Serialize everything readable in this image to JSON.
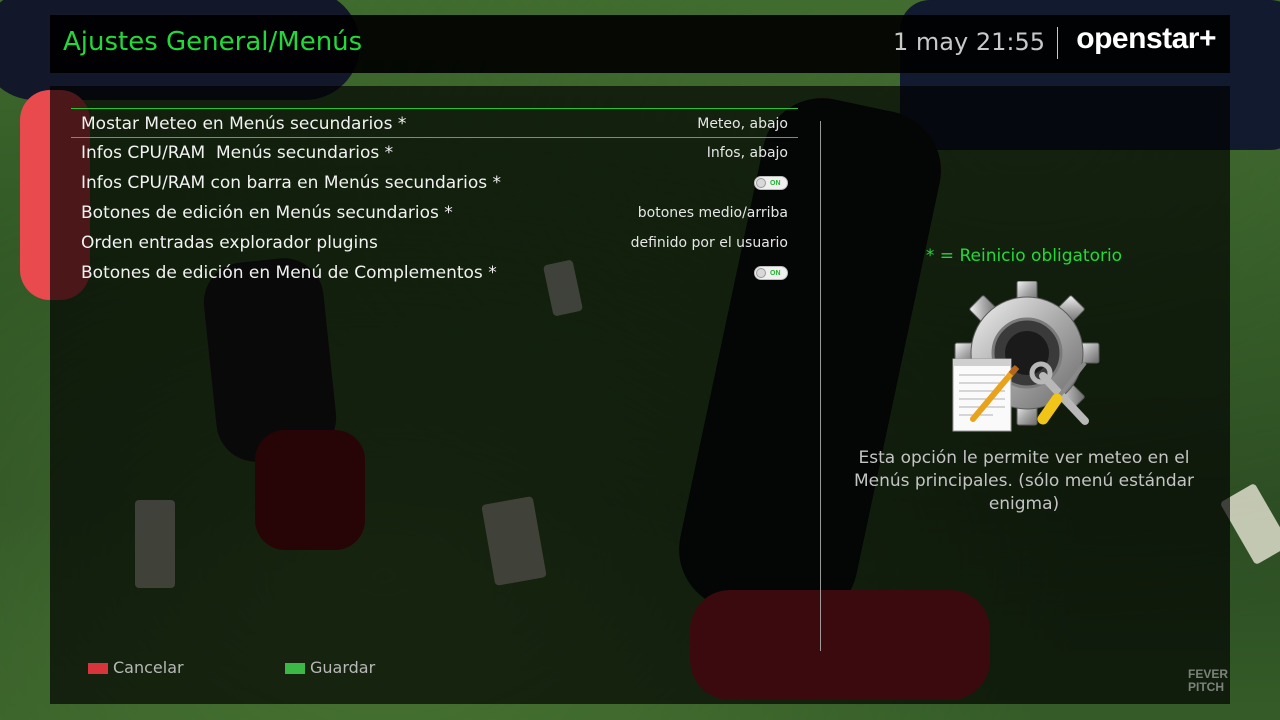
{
  "header": {
    "title": "Ajustes General/Menús",
    "datetime": "1 may 21:55",
    "brand": "openstar+"
  },
  "settings": [
    {
      "label": "Mostar Meteo en Menús secundarios *",
      "value": "Meteo, abajo",
      "selected": true
    },
    {
      "label": "Infos CPU/RAM  Menús secundarios *",
      "value": "Infos, abajo"
    },
    {
      "label": "Infos CPU/RAM con barra en Menús secundarios *",
      "toggle": "ON"
    },
    {
      "label": "Botones de edición en Menús secundarios *",
      "value": "botones medio/arriba"
    },
    {
      "label": "Orden entradas explorador plugins",
      "value": "definido por el usuario"
    },
    {
      "label": "Botones de edición en Menú de Complementos *",
      "toggle": "ON"
    }
  ],
  "info": {
    "restart_note": "* = Reinicio obligatorio",
    "help": "Esta opción le permite ver meteo en el Menús principales. (sólo menú estándar enigma)",
    "illustration_icon": "gear-wrench-screwdriver-notepad-icon"
  },
  "footer": {
    "cancel_label": "Cancelar",
    "save_label": "Guardar",
    "cancel_color": "#d8343c",
    "save_color": "#3cb847"
  },
  "watermark": {
    "line1": "FEVER",
    "line2": "PITCH"
  },
  "colors": {
    "accent_green": "#22d93a",
    "selection_border": "#22c832"
  }
}
